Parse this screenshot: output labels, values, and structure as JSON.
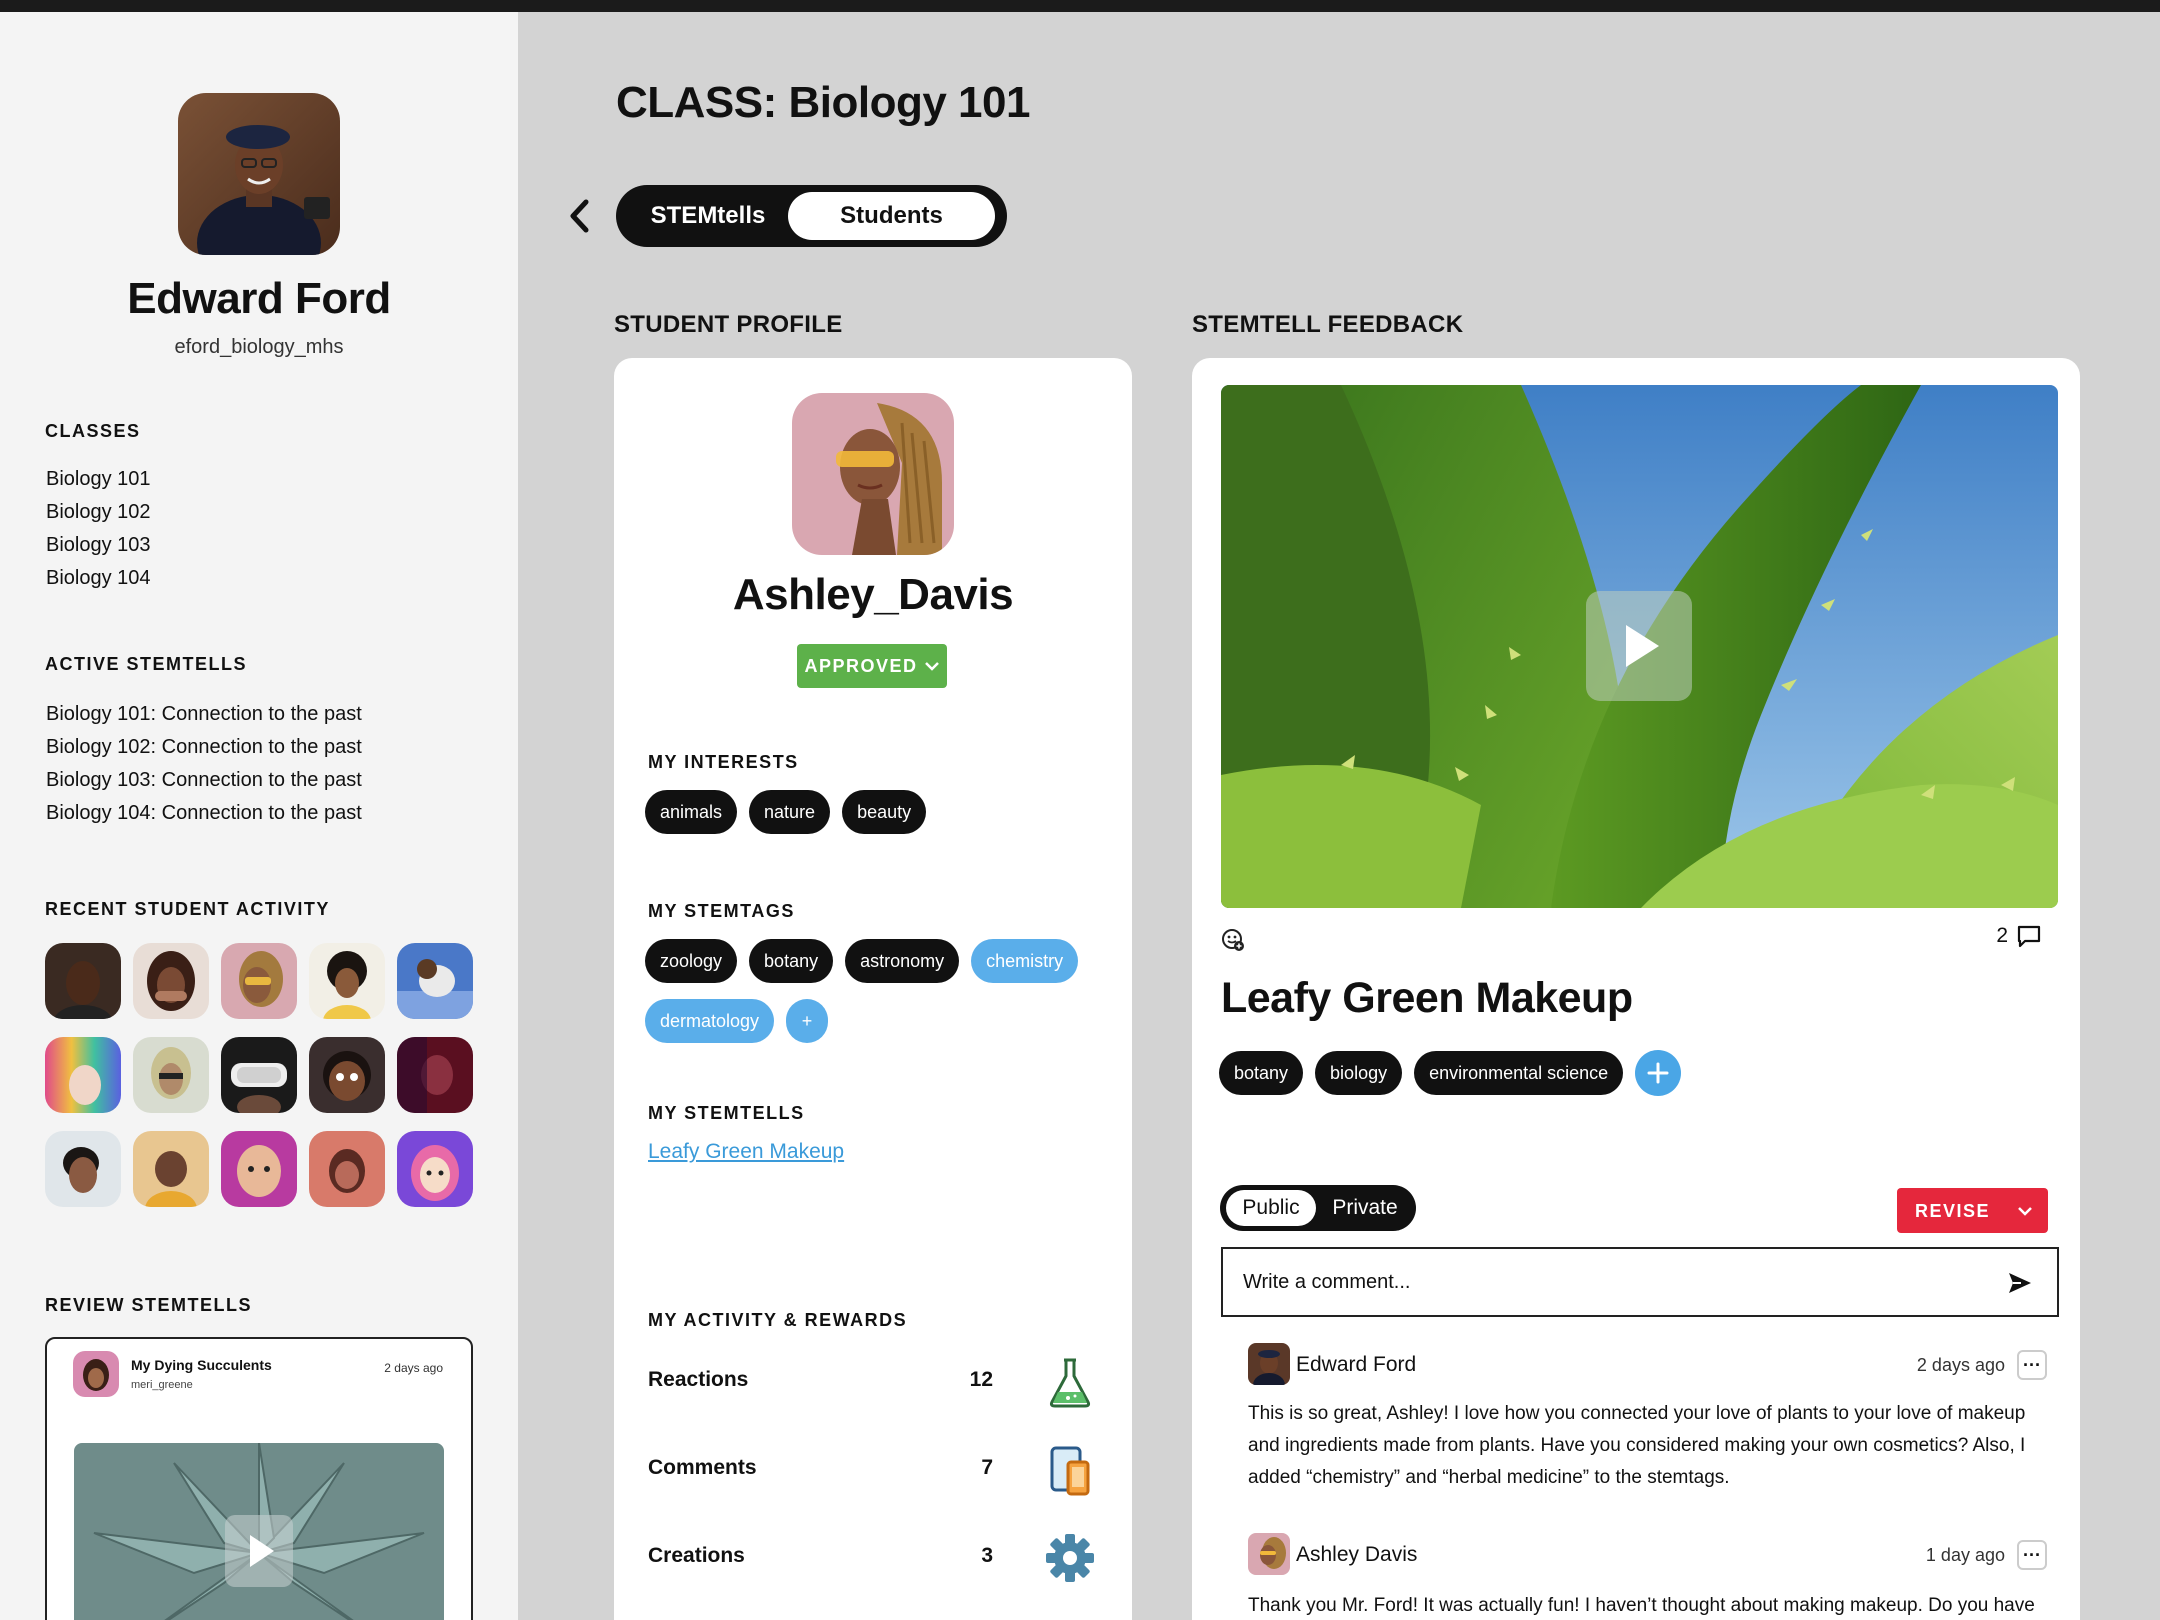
{
  "teacher": {
    "name": "Edward Ford",
    "handle": "eford_biology_mhs"
  },
  "sidebar": {
    "classes_heading": "CLASSES",
    "classes": [
      "Biology 101",
      "Biology 102",
      "Biology 103",
      "Biology 104"
    ],
    "active_heading": "ACTIVE STEMTELLS",
    "active_stemtells": [
      "Biology 101: Connection to the past",
      "Biology 102: Connection to the past",
      "Biology 103: Connection to the past",
      "Biology 104: Connection to the past"
    ],
    "activity_heading": "RECENT STUDENT ACTIVITY",
    "review_heading": "REVIEW STEMTELLS",
    "review_card": {
      "title": "My Dying Succulents",
      "user": "meri_greene",
      "time": "2 days ago"
    }
  },
  "main": {
    "title": "CLASS: Biology 101",
    "tabs": [
      "STEMtells",
      "Students"
    ],
    "active_tab": "Students",
    "profile_heading": "STUDENT PROFILE",
    "feedback_heading": "STEMTELL FEEDBACK"
  },
  "profile": {
    "name": "Ashley_Davis",
    "status": "APPROVED",
    "interests_heading": "MY INTERESTS",
    "interests": [
      "animals",
      "nature",
      "beauty"
    ],
    "stemtags_heading": "MY STEMTAGS",
    "stemtags_dark": [
      "zoology",
      "botany",
      "astronomy"
    ],
    "stemtags_blue": [
      "chemistry",
      "dermatology"
    ],
    "add_label": "+",
    "stemtells_heading": "MY STEMTELLS",
    "stemtell_link": "Leafy Green Makeup",
    "rewards_heading": "MY ACTIVITY & REWARDS",
    "rewards": [
      {
        "label": "Reactions",
        "value": "12",
        "icon": "flask-icon"
      },
      {
        "label": "Comments",
        "value": "7",
        "icon": "tablet-phone-icon"
      },
      {
        "label": "Creations",
        "value": "3",
        "icon": "gear-icon"
      }
    ]
  },
  "feedback": {
    "title": "Leafy Green Makeup",
    "comment_count": "2",
    "tags": [
      "botany",
      "biology",
      "environmental science"
    ],
    "visibility": [
      "Public",
      "Private"
    ],
    "visibility_selected": "Public",
    "revise_label": "REVISE",
    "comment_placeholder": "Write a comment...",
    "comments": [
      {
        "author": "Edward Ford",
        "time": "2 days ago",
        "lines": [
          "This is so great, Ashley! I love how you connected your love of plants to your love of makeup",
          "and ingredients made from plants. Have you considered making your own cosmetics? Also, I",
          "added “chemistry” and “herbal medicine” to the stemtags."
        ]
      },
      {
        "author": "Ashley Davis",
        "time": "1 day ago",
        "lines": [
          "Thank you Mr. Ford! It was actually fun! I haven’t thought about making makeup. Do you have"
        ]
      }
    ]
  },
  "colors": {
    "approved": "#5db14a",
    "revise": "#e5273c",
    "tag_blue": "#5aaeea",
    "link_blue": "#3a9ad9",
    "panel_bg": "#d3d3d3"
  }
}
